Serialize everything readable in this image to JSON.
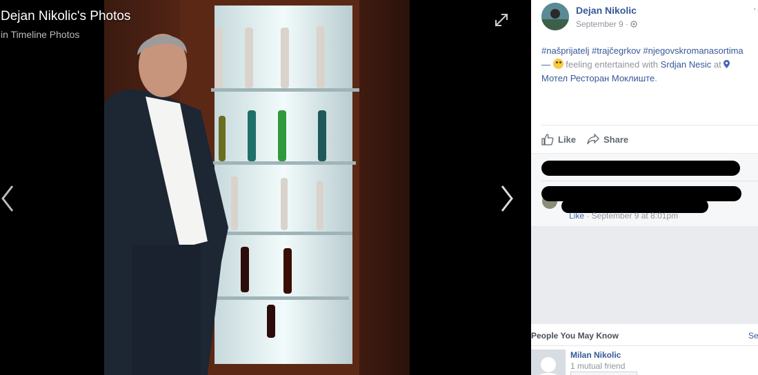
{
  "viewer": {
    "album_title": "Dejan Nikolic's Photos",
    "album_subtitle": "in Timeline Photos"
  },
  "post": {
    "author": "Dejan Nikolic",
    "date": "September 9 · ",
    "more_glyph": "·",
    "hashtags": "#našprijatelj #trajčegrkov #njegovskromanasortima",
    "dash": "— ",
    "feeling": " feeling entertained with ",
    "tagged_person": "Srdjan Nesic",
    "at": " at ",
    "location": "Мотел Ресторан Моклиште",
    "period": "."
  },
  "actions": {
    "like": "Like",
    "share": "Share"
  },
  "comment": {
    "like": "Like",
    "time": " · September 9 at 8:01pm"
  },
  "pymk": {
    "heading": "People You May Know",
    "see_all": "Se",
    "name": "Milan Nikolic",
    "mutual": "1 mutual friend"
  },
  "colors": {
    "link": "#365899",
    "meta": "#90949c",
    "panel_bg": "#e9ebee"
  }
}
